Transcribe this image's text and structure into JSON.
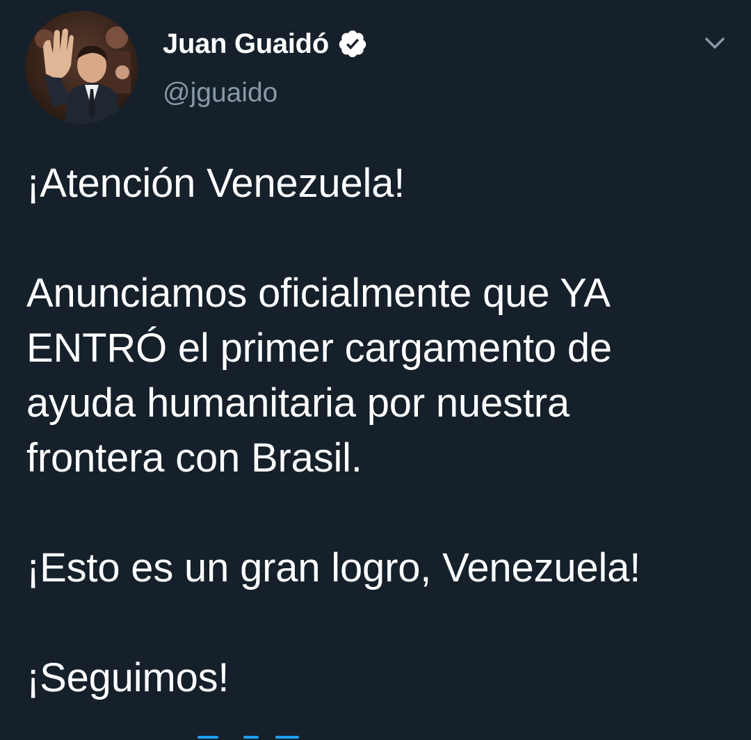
{
  "author": {
    "display_name": "Juan Guaidó",
    "handle": "@jguaido",
    "verified": true,
    "avatar_icon": "profile-photo"
  },
  "menu": {
    "caret_icon": "chevron-down-icon"
  },
  "tweet": {
    "paragraphs": [
      "¡Atención Venezuela!",
      "Anunciamos oficialmente que YA\nENTRÓ el primer cargamento de\nayuda humanitaria por nuestra\nfrontera con Brasil.",
      "¡Esto es un gran logro, Venezuela!",
      "¡Seguimos!"
    ]
  },
  "colors": {
    "background": "#15202b",
    "text": "#ffffff",
    "secondary_text": "#8899a6",
    "verified_badge": "#ffffff",
    "link": "#1da1f2"
  }
}
